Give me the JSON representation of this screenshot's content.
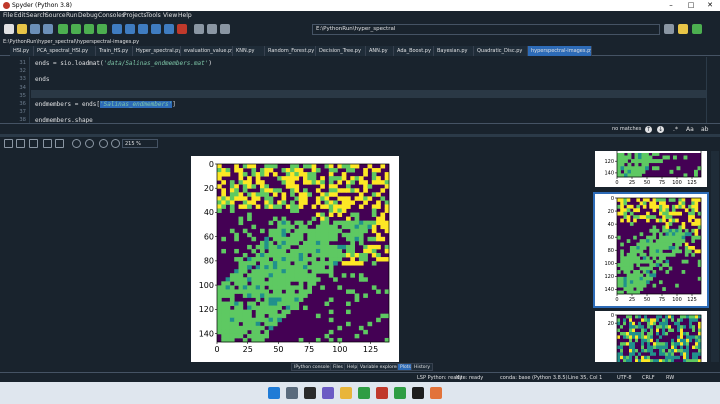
{
  "window": {
    "title": "Spyder (Python 3.8)"
  },
  "menu": [
    "File",
    "Edit",
    "Search",
    "Source",
    "Run",
    "Debug",
    "Consoles",
    "Projects",
    "Tools",
    "View",
    "Help"
  ],
  "toolbar": {
    "path": "E:\\PythonRun\\hyper_spectral"
  },
  "editor": {
    "filepath": "E:\\PythonRun\\hyper_spectral\\hyperspectral-images.py",
    "tabs": [
      "HSI.py",
      "PCA_spectral_HSI.py",
      "Train_HS.py",
      "Hyper_spectral.py",
      "evaluation_value.py",
      "KNN.py",
      "Random_Forest.py",
      "Decision_Tree.py",
      "ANN.py",
      "Ada_Boost.py",
      "Bayesian.py",
      "Quadratic_Disc.py",
      "hyperspectral-images.py"
    ],
    "active_tab": "hyperspectral-images.py",
    "lines": [
      {
        "num": "31",
        "pre": "ends = sio.loadmat(",
        "str": "'data/Salinas_endmembers.mat'",
        "post": ")"
      },
      {
        "num": "32",
        "pre": "",
        "str": "",
        "post": ""
      },
      {
        "num": "33",
        "pre": "ends",
        "str": "",
        "post": ""
      },
      {
        "num": "34",
        "pre": "",
        "str": "",
        "post": ""
      },
      {
        "num": "35",
        "pre": "",
        "str": "",
        "post": ""
      },
      {
        "num": "36",
        "pre": "endmembers = ends[",
        "str": "'Salinas_endmembers'",
        "post": "]"
      },
      {
        "num": "37",
        "pre": "",
        "str": "",
        "post": ""
      },
      {
        "num": "38",
        "pre": "endmembers.shape",
        "str": "",
        "post": ""
      }
    ]
  },
  "find": {
    "status": "no matches"
  },
  "plots": {
    "zoom": "215 %",
    "main": {
      "xticks": [
        "0",
        "25",
        "50",
        "75",
        "100",
        "125"
      ],
      "yticks": [
        "0",
        "20",
        "40",
        "60",
        "80",
        "100",
        "120",
        "140"
      ]
    },
    "thumbs": [
      {
        "yticks": [
          "120",
          "140"
        ],
        "xticks": [
          "0",
          "25",
          "50",
          "75",
          "100",
          "125"
        ]
      },
      {
        "yticks": [
          "0",
          "20",
          "40",
          "60",
          "80",
          "100",
          "120",
          "140"
        ],
        "xticks": [
          "0",
          "25",
          "50",
          "75",
          "100",
          "125"
        ]
      },
      {
        "yticks": [
          "0",
          "20"
        ],
        "xticks": []
      }
    ]
  },
  "pane_tabs": [
    "IPython console",
    "Files",
    "Help",
    "Variable explorer",
    "Plots",
    "History"
  ],
  "active_pane_tab": "Plots",
  "status": {
    "lsp": "LSP Python: ready",
    "kite": "Kite: ready",
    "conda": "conda: base (Python 3.8.5)",
    "position": "Line 35, Col 1",
    "encoding": "UTF-8",
    "eol": "CRLF",
    "perm": "RW"
  },
  "colors": {
    "viridis_dark": "#440154",
    "viridis_teal": "#21918c",
    "viridis_green": "#5ec962",
    "viridis_yellow": "#fde725",
    "accent": "#2d6bb7"
  }
}
